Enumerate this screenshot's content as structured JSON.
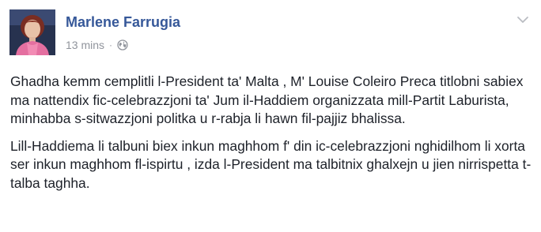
{
  "post": {
    "author": "Marlene Farrugia",
    "timestamp": "13 mins",
    "separator": "·",
    "privacy_icon": "globe-icon",
    "menu_icon": "chevron-down-icon",
    "paragraphs": [
      "Ghadha kemm cemplitli l-President ta' Malta , M' Louise Coleiro Preca titlobni sabiex ma nattendix fic-celebrazzjoni ta' Jum il-Haddiem organizzata mill-Partit Laburista, minhabba s-sitwazzjoni politka u r-rabja li hawn fil-pajjiz bhalissa.",
      "Lill-Haddiema li talbuni biex inkun maghhom f' din ic-celebrazzjoni nghidilhom li xorta ser inkun maghhom fl-ispirtu , izda l-President ma talbitnix ghalxejn u jien nirrispetta t-talba taghha."
    ]
  },
  "colors": {
    "author_link": "#365899",
    "meta_text": "#90949c",
    "body_text": "#1d2129",
    "avatar_bg": "#27324f"
  }
}
